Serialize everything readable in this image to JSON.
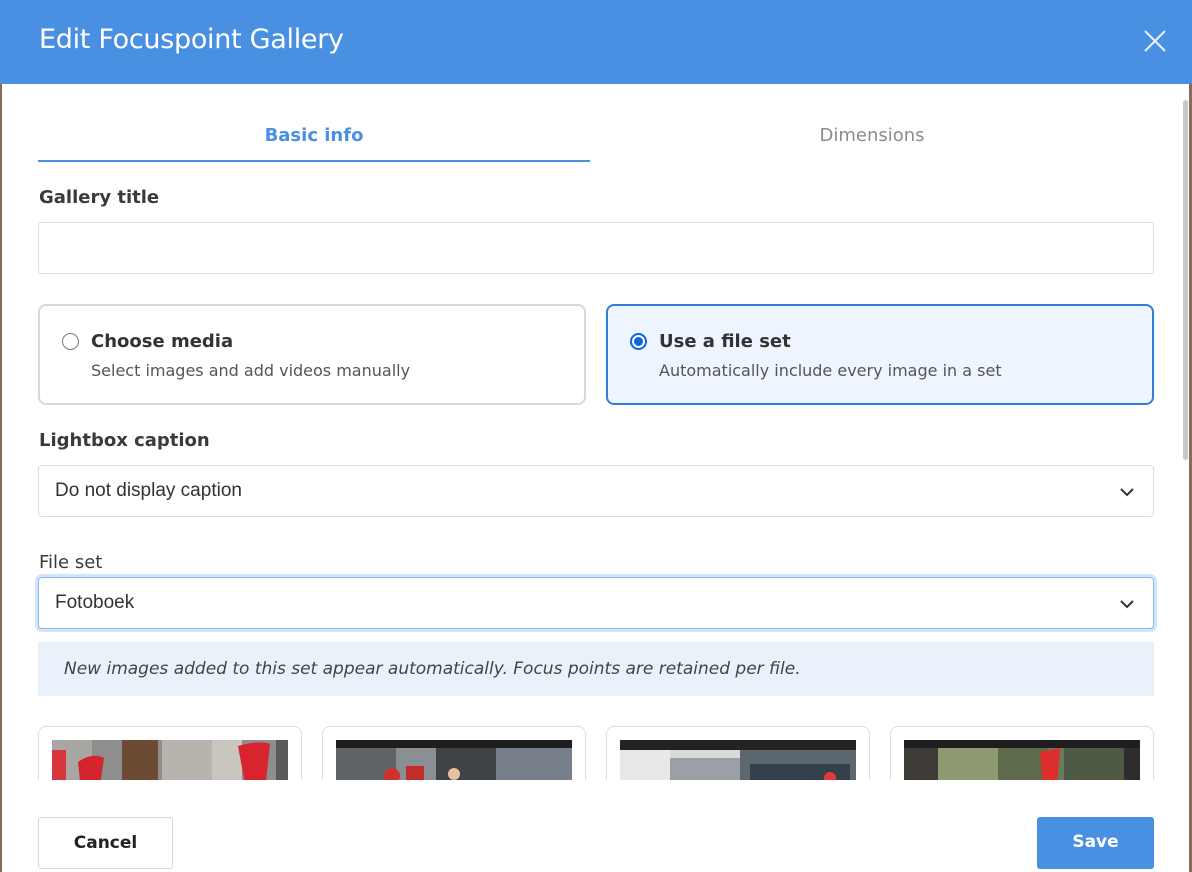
{
  "dialog": {
    "title": "Edit Focuspoint Gallery",
    "close_icon": "close-icon"
  },
  "tabs": [
    {
      "label": "Basic info",
      "active": true
    },
    {
      "label": "Dimensions",
      "active": false
    }
  ],
  "gallery_title": {
    "label": "Gallery title",
    "value": ""
  },
  "source_options": [
    {
      "title": "Choose media",
      "description": "Select images and add videos manually",
      "selected": false
    },
    {
      "title": "Use a file set",
      "description": "Automatically include every image in a set",
      "selected": true
    }
  ],
  "lightbox_caption": {
    "label": "Lightbox caption",
    "value": "Do not display caption"
  },
  "file_set": {
    "label": "File set",
    "value": "Fotoboek"
  },
  "info_note": "New images added to this set appear automatically. Focus points are retained per file.",
  "footer": {
    "cancel_label": "Cancel",
    "save_label": "Save"
  },
  "colors": {
    "accent": "#4a90e2",
    "selected_border": "#2f7fe0",
    "selected_bg": "#eef5fe",
    "info_bg": "#e9f2fb"
  }
}
